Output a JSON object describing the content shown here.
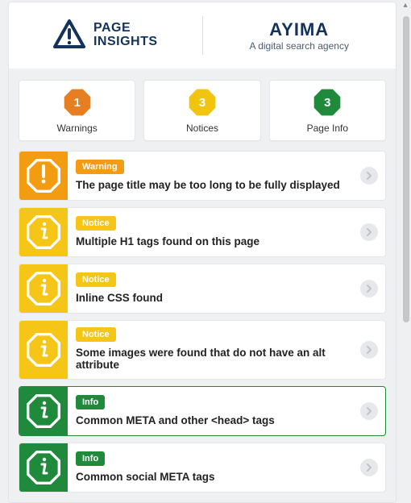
{
  "header": {
    "logo_line1": "PAGE",
    "logo_line2": "INSIGHTS",
    "brand": "AYIMA",
    "brand_tag": "A digital search agency"
  },
  "summary": [
    {
      "count": "1",
      "label": "Warnings",
      "color": "#e67e22"
    },
    {
      "count": "3",
      "label": "Notices",
      "color": "#f1c40f"
    },
    {
      "count": "3",
      "label": "Page Info",
      "color": "#1f8a3b"
    }
  ],
  "severity_labels": {
    "warning": "Warning",
    "notice": "Notice",
    "info": "Info"
  },
  "items": [
    {
      "severity": "warning",
      "message": "The page title may be too long to be fully displayed",
      "bg": "#f39c12",
      "badge": "#f39c12",
      "icon": "exclaim"
    },
    {
      "severity": "notice",
      "message": "Multiple H1 tags found on this page",
      "bg": "#f5c518",
      "badge": "#f5c518",
      "icon": "info"
    },
    {
      "severity": "notice",
      "message": "Inline CSS found",
      "bg": "#f5c518",
      "badge": "#f5c518",
      "icon": "info"
    },
    {
      "severity": "notice",
      "message": "Some images were found that do not have an alt attribute",
      "bg": "#f5c518",
      "badge": "#f5c518",
      "icon": "info"
    },
    {
      "severity": "info",
      "message": "Common META and other <head> tags",
      "bg": "#1f8a3b",
      "badge": "#1f8a3b",
      "icon": "info",
      "selected": true
    },
    {
      "severity": "info",
      "message": "Common social META tags",
      "bg": "#1f8a3b",
      "badge": "#1f8a3b",
      "icon": "info"
    }
  ]
}
